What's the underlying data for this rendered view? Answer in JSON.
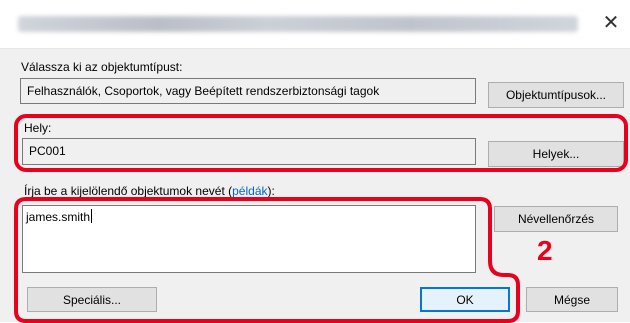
{
  "window": {
    "close_glyph": "✕"
  },
  "object_type": {
    "label": "Válassza ki az objektumtípust:",
    "value": "Felhasználók, Csoportok, vagy Beépített rendszerbiztonsági tagok",
    "button": "Objektumtípusok..."
  },
  "location": {
    "label": "Hely:",
    "value": "PC001",
    "button": "Helyek..."
  },
  "names": {
    "label_prefix": "Írja be a kijelölendő objektumok nevét (",
    "label_link": "példák",
    "label_suffix": "):",
    "value": "james.smith",
    "check_button": "Névellenőrzés"
  },
  "footer": {
    "advanced_button": "Speciális...",
    "ok_button": "OK",
    "cancel_button": "Mégse"
  },
  "annotation": {
    "step_number": "2",
    "color": "#e8001c"
  },
  "colors": {
    "accent": "#0078d7",
    "link": "#0066cc",
    "dialog_bg": "#f0f0f0"
  }
}
